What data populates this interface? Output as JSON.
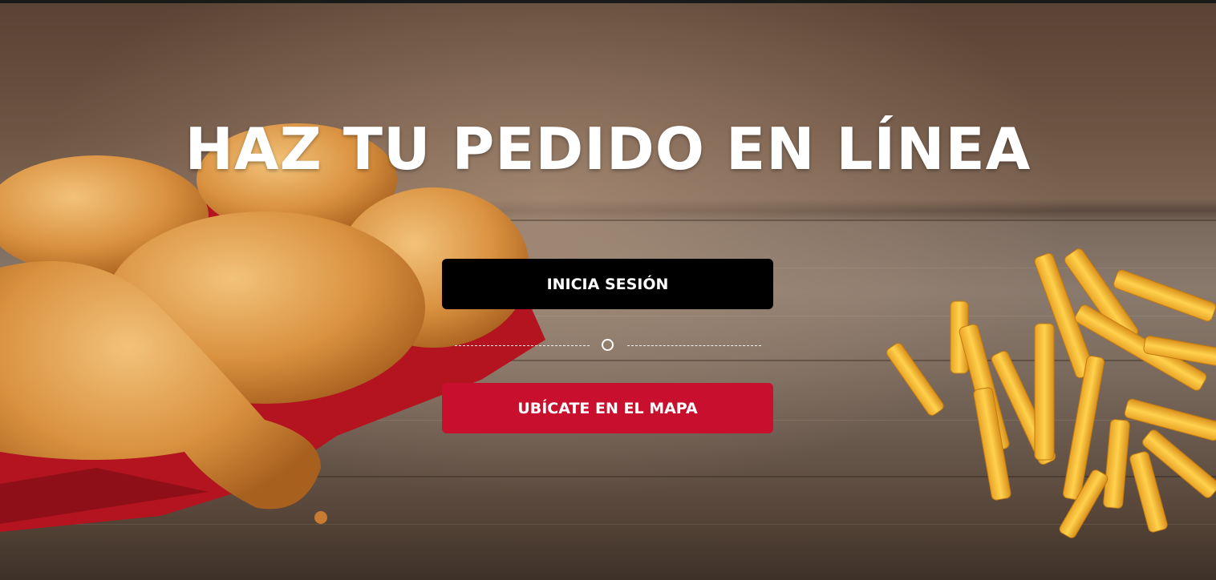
{
  "hero": {
    "title": "HAZ TU PEDIDO EN LÍNEA",
    "login_button": "INICIA SESIÓN",
    "divider_text": "O",
    "map_button": "UBÍCATE EN EL MAPA"
  },
  "colors": {
    "login_bg": "#000000",
    "map_bg": "#c8102e",
    "text": "#ffffff"
  }
}
